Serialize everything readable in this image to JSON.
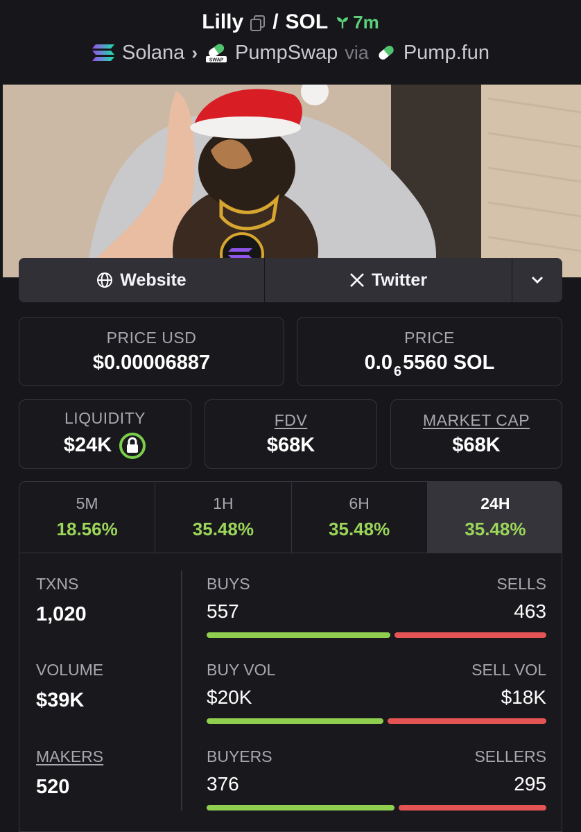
{
  "header": {
    "token": "Lilly",
    "separator": "/",
    "quote": "SOL",
    "age": "7m",
    "chain": "Solana",
    "dex": "PumpSwap",
    "via": "via",
    "launchpad": "Pump.fun"
  },
  "links": {
    "website": "Website",
    "twitter": "Twitter"
  },
  "price": {
    "usd_label": "PRICE USD",
    "usd_value": "$0.00006887",
    "native_label": "PRICE",
    "native_prefix": "0.0",
    "native_zeros": "6",
    "native_digits": "5560 SOL"
  },
  "metrics_row": {
    "liquidity_label": "LIQUIDITY",
    "liquidity_value": "$24K",
    "fdv_label": "FDV",
    "fdv_value": "$68K",
    "mcap_label": "MARKET CAP",
    "mcap_value": "$68K"
  },
  "timeframes": [
    {
      "label": "5M",
      "change": "18.56%"
    },
    {
      "label": "1H",
      "change": "35.48%"
    },
    {
      "label": "6H",
      "change": "35.48%"
    },
    {
      "label": "24H",
      "change": "35.48%",
      "active": true
    }
  ],
  "stats": {
    "txns_label": "TXNS",
    "txns_value": "1,020",
    "volume_label": "VOLUME",
    "volume_value": "$39K",
    "makers_label": "MAKERS",
    "makers_value": "520",
    "buys_label": "BUYS",
    "buys_value": "557",
    "sells_label": "SELLS",
    "sells_value": "463",
    "buy_vol_label": "BUY VOL",
    "buy_vol_value": "$20K",
    "sell_vol_label": "SELL VOL",
    "sell_vol_value": "$18K",
    "buyers_label": "BUYERS",
    "buyers_value": "376",
    "sellers_label": "SELLERS",
    "sellers_value": "295",
    "buys_fraction": 0.546,
    "buy_vol_fraction": 0.526,
    "buyers_fraction": 0.56
  },
  "colors": {
    "positive": "#9bd65a",
    "buy_bar": "#8fce4e",
    "sell_bar": "#e55454",
    "age": "#5ad17a"
  },
  "icons": [
    "copy-icon",
    "sprout-icon",
    "solana-logo-icon",
    "pumpswap-logo-icon",
    "pill-icon",
    "globe-icon",
    "x-logo-icon",
    "chevron-down-icon",
    "lock-icon"
  ]
}
